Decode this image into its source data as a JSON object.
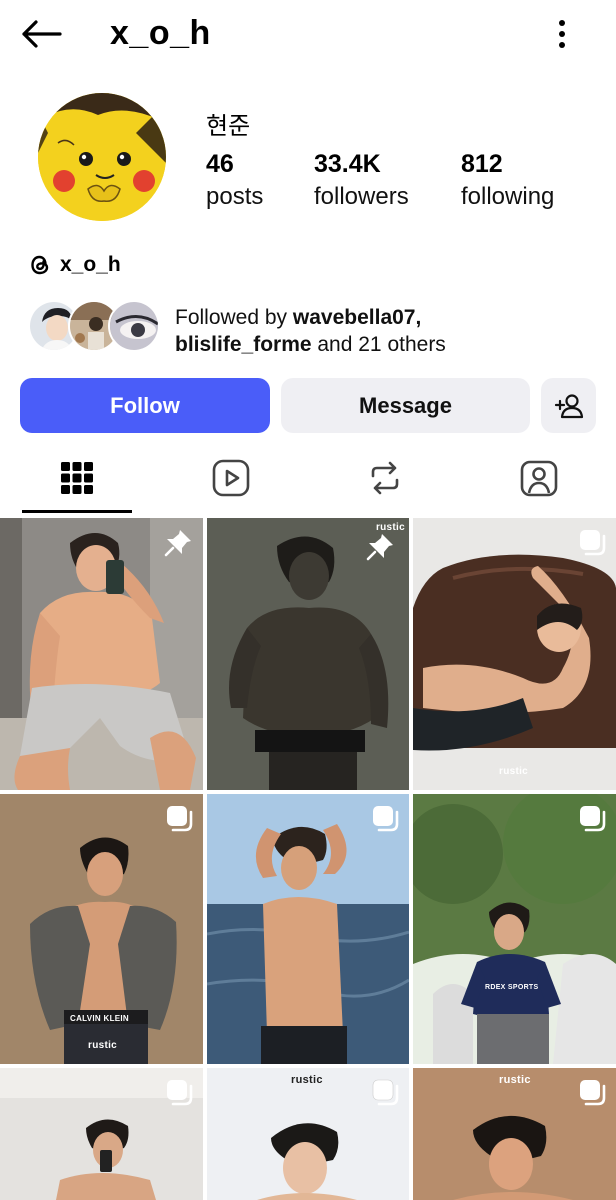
{
  "header": {
    "back_icon": "arrow-left-icon",
    "username": "x_o_h",
    "more_icon": "more-vertical-icon"
  },
  "profile": {
    "display_name": "현준",
    "stats": [
      {
        "value": "46",
        "label": "posts"
      },
      {
        "value": "33.4K",
        "label": "followers"
      },
      {
        "value": "812",
        "label": "following"
      }
    ],
    "threads_handle": "x_o_h",
    "followed_by": {
      "prefix": "Followed by ",
      "user1": "wavebella07,",
      "user2": "blislife_forme",
      "suffix": " and 21 others"
    }
  },
  "actions": {
    "follow": "Follow",
    "message": "Message",
    "add_user_icon": "add-user-icon",
    "follow_color": "#4a5df9"
  },
  "tabs": [
    {
      "name": "posts-grid",
      "icon": "grid-icon",
      "active": true
    },
    {
      "name": "reels",
      "icon": "reels-icon",
      "active": false
    },
    {
      "name": "reposts",
      "icon": "repost-icon",
      "active": false
    },
    {
      "name": "tagged",
      "icon": "tagged-icon",
      "active": false
    }
  ],
  "grid": {
    "posts": [
      {
        "badge": "pin-icon",
        "watermark": ""
      },
      {
        "badge": "pin-icon",
        "watermark": "rustic"
      },
      {
        "badge": "carousel-icon",
        "watermark": "rustic"
      },
      {
        "badge": "carousel-icon",
        "watermark": "rustic"
      },
      {
        "badge": "carousel-icon",
        "watermark": ""
      },
      {
        "badge": "carousel-icon",
        "watermark": ""
      },
      {
        "badge": "carousel-icon",
        "watermark": ""
      },
      {
        "badge": "carousel-icon",
        "watermark": "rustic"
      },
      {
        "badge": "carousel-icon",
        "watermark": "rustic"
      }
    ],
    "shirt_text": "RDEX SPORTS",
    "waistband_text": "CALVIN KLEIN"
  }
}
